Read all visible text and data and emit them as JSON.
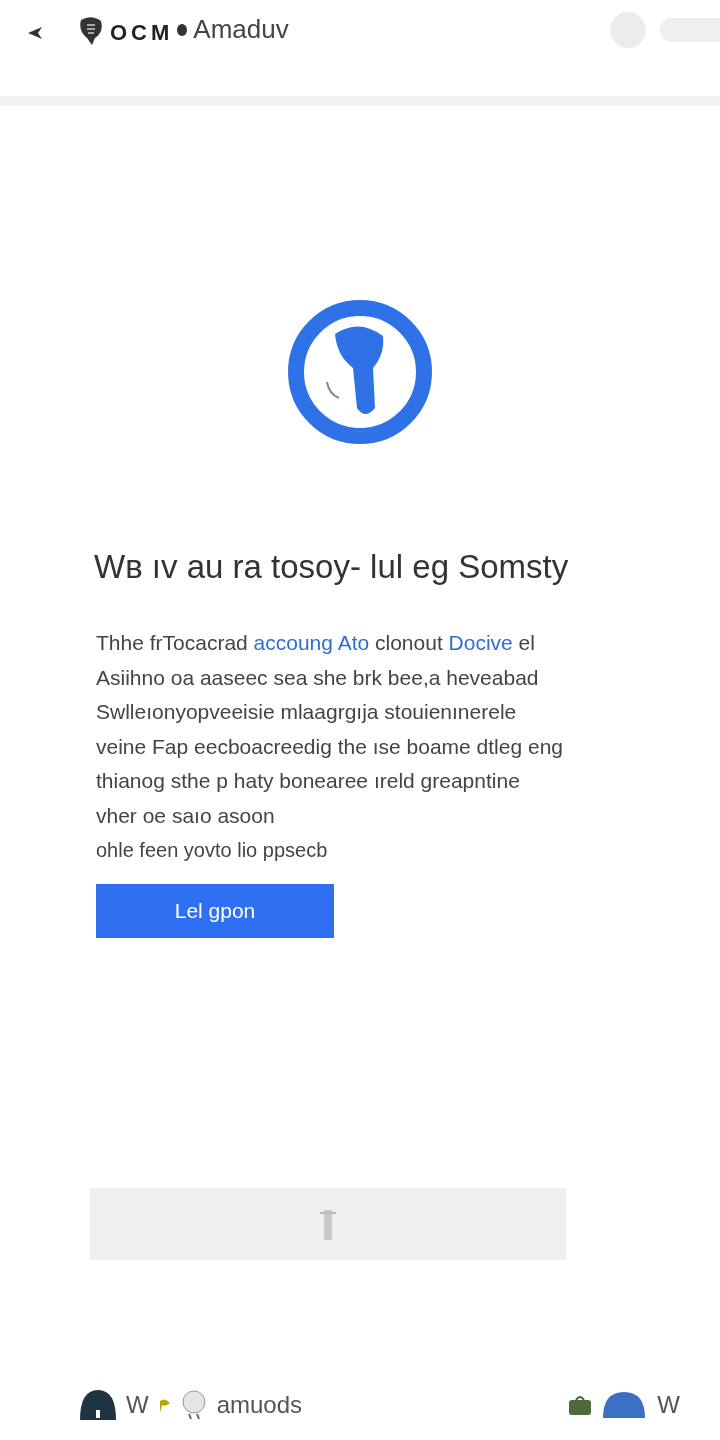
{
  "header": {
    "brand": "OCM",
    "title": "Amaduv"
  },
  "heading": "Wв ıv au ra tosoy- lul eg Somsty",
  "paragraph": {
    "lines": [
      [
        {
          "text": "Thhe frTocacrad ",
          "kind": "text"
        },
        {
          "text": "accoung Ato",
          "kind": "link"
        },
        {
          "text": " clonout ",
          "kind": "text"
        },
        {
          "text": "Docive",
          "kind": "link"
        },
        {
          "text": " el",
          "kind": "text"
        }
      ],
      [
        {
          "text": "Asiihno oa aaseec sea she brk bee,a heveabad",
          "kind": "text"
        }
      ],
      [
        {
          "text": "Swlleıonyopveeisie mlaagrgıja stouienınerele",
          "kind": "text"
        }
      ],
      [
        {
          "text": "veine Fap eecboacreedig the ıse boame dtleg eng",
          "kind": "text"
        }
      ],
      [
        {
          "text": " thianog sthe p haty bonearee ıreld greapntine",
          "kind": "text"
        }
      ],
      [
        {
          "text": "vher oe saıo asoon",
          "kind": "text"
        }
      ]
    ]
  },
  "note": "ohle feen yovto lio ppsecb",
  "button": "Lel gpon",
  "footer": {
    "left_texts": [
      "W",
      "amuods"
    ],
    "right_text": "W"
  }
}
